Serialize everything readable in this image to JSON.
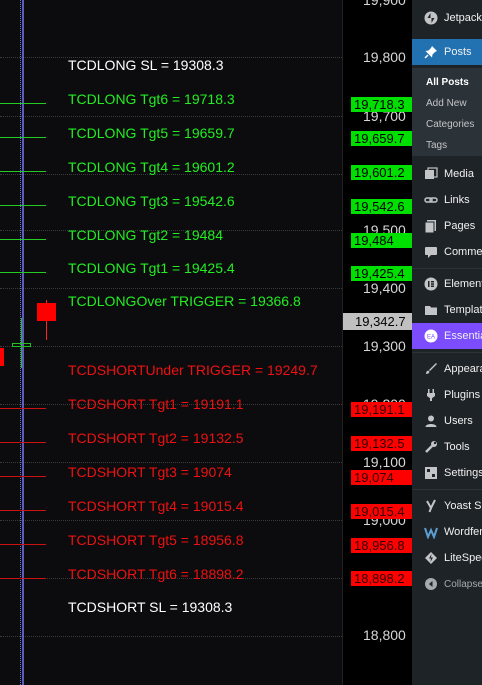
{
  "chart": {
    "levels": [
      {
        "label": "TCDLONG SL = 19308.3",
        "color": "white"
      },
      {
        "label": "TCDLONG Tgt6 = 19718.3",
        "color": "green"
      },
      {
        "label": "TCDLONG Tgt5 = 19659.7",
        "color": "green"
      },
      {
        "label": "TCDLONG Tgt4 = 19601.2",
        "color": "green"
      },
      {
        "label": "TCDLONG Tgt3 = 19542.6",
        "color": "green"
      },
      {
        "label": "TCDLONG Tgt2 = 19484",
        "color": "green"
      },
      {
        "label": "TCDLONG Tgt1 = 19425.4",
        "color": "green"
      },
      {
        "label": "TCDLONGOver TRIGGER = 19366.8",
        "color": "green"
      },
      {
        "label": "TCDSHORTUnder TRIGGER = 19249.7",
        "color": "red"
      },
      {
        "label": "TCDSHORT Tgt1 = 19191.1",
        "color": "red"
      },
      {
        "label": "TCDSHORT Tgt2 = 19132.5",
        "color": "red"
      },
      {
        "label": "TCDSHORT Tgt3 = 19074",
        "color": "red"
      },
      {
        "label": "TCDSHORT Tgt4 = 19015.4",
        "color": "red"
      },
      {
        "label": "TCDSHORT Tgt5 = 18956.8",
        "color": "red"
      },
      {
        "label": "TCDSHORT Tgt6 = 18898.2",
        "color": "red"
      },
      {
        "label": "TCDSHORT SL = 19308.3",
        "color": "white"
      }
    ],
    "colors": {
      "green": "#22ee22",
      "red": "#ee1111",
      "white": "#ffffff",
      "crosshair": "#8080ff"
    }
  },
  "axis": {
    "ticks": [
      "19,900",
      "19,800",
      "19,700",
      "19,500",
      "19,400",
      "19,300",
      "19,200",
      "19,100",
      "19,000",
      "18,800"
    ],
    "badges": [
      {
        "text": "19,718.3",
        "color": "green"
      },
      {
        "text": "19,659.7",
        "color": "green"
      },
      {
        "text": "19,601.2",
        "color": "green"
      },
      {
        "text": "19,542.6",
        "color": "green"
      },
      {
        "text": "19,484",
        "color": "green"
      },
      {
        "text": "19,425.4",
        "color": "green"
      },
      {
        "text": "19,191.1",
        "color": "red"
      },
      {
        "text": "19,132.5",
        "color": "red"
      },
      {
        "text": "19,074",
        "color": "red"
      },
      {
        "text": "19,015.4",
        "color": "red"
      },
      {
        "text": "18,956.8",
        "color": "red"
      },
      {
        "text": "18,898.2",
        "color": "red"
      }
    ],
    "current_price": "19,342.7"
  },
  "sidebar": {
    "items": [
      {
        "label": "Jetpack",
        "icon": "jetpack-icon"
      },
      {
        "label": "Posts",
        "icon": "pushpin-icon",
        "active": true
      },
      {
        "label": "Media",
        "icon": "media-icon"
      },
      {
        "label": "Links",
        "icon": "link-icon"
      },
      {
        "label": "Pages",
        "icon": "pages-icon"
      },
      {
        "label": "Comments",
        "icon": "comments-icon"
      },
      {
        "label": "Elementor",
        "icon": "elementor-icon"
      },
      {
        "label": "Templates",
        "icon": "templates-icon"
      },
      {
        "label": "Essential Addons",
        "icon": "essential-addons-icon",
        "highlight": true
      },
      {
        "label": "Appearance",
        "icon": "appearance-icon"
      },
      {
        "label": "Plugins",
        "icon": "plugins-icon"
      },
      {
        "label": "Users",
        "icon": "users-icon"
      },
      {
        "label": "Tools",
        "icon": "tools-icon"
      },
      {
        "label": "Settings",
        "icon": "settings-icon"
      },
      {
        "label": "Yoast SEO",
        "icon": "yoast-icon"
      },
      {
        "label": "Wordfence",
        "icon": "wordfence-icon"
      },
      {
        "label": "LiteSpeed Cache",
        "icon": "litespeed-icon"
      },
      {
        "label": "Collapse menu",
        "icon": "collapse-icon"
      }
    ],
    "submenu": [
      "All Posts",
      "Add New",
      "Categories",
      "Tags"
    ]
  }
}
